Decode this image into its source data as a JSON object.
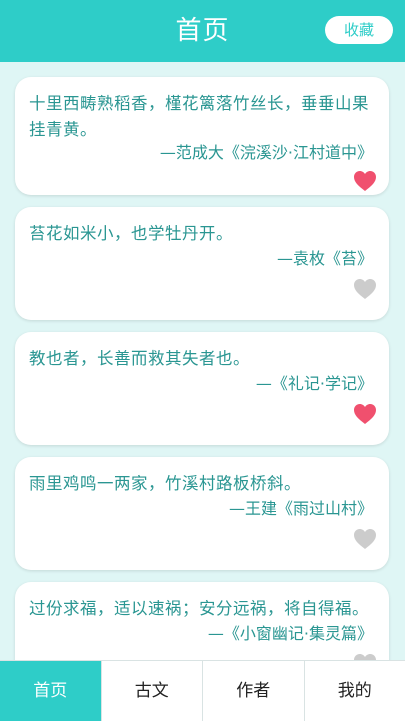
{
  "header": {
    "title": "首页",
    "favorite_button": "收藏"
  },
  "colors": {
    "accent": "#2ecdc8",
    "text": "#2a9692",
    "heart_active": "#f0506e",
    "heart_inactive": "#cccccc"
  },
  "quotes": [
    {
      "text": "十里西畴熟稻香，槿花篱落竹丝长，垂垂山果挂青黄。",
      "source": "—范成大《浣溪沙·江村道中》",
      "favorited": true,
      "heart_icon": "heart-filled-icon"
    },
    {
      "text": "苔花如米小，也学牡丹开。",
      "source": "—袁枚《苔》",
      "favorited": false,
      "heart_icon": "heart-outline-icon"
    },
    {
      "text": "教也者，长善而救其失者也。",
      "source": "—《礼记·学记》",
      "favorited": true,
      "heart_icon": "heart-filled-icon"
    },
    {
      "text": "雨里鸡鸣一两家，竹溪村路板桥斜。",
      "source": "—王建《雨过山村》",
      "favorited": false,
      "heart_icon": "heart-outline-icon"
    },
    {
      "text": "过份求福，适以速祸；安分远祸，将自得福。",
      "source": "—《小窗幽记·集灵篇》",
      "favorited": false,
      "heart_icon": "heart-outline-icon"
    }
  ],
  "tabs": [
    {
      "label": "首页",
      "active": true
    },
    {
      "label": "古文",
      "active": false
    },
    {
      "label": "作者",
      "active": false
    },
    {
      "label": "我的",
      "active": false
    }
  ]
}
